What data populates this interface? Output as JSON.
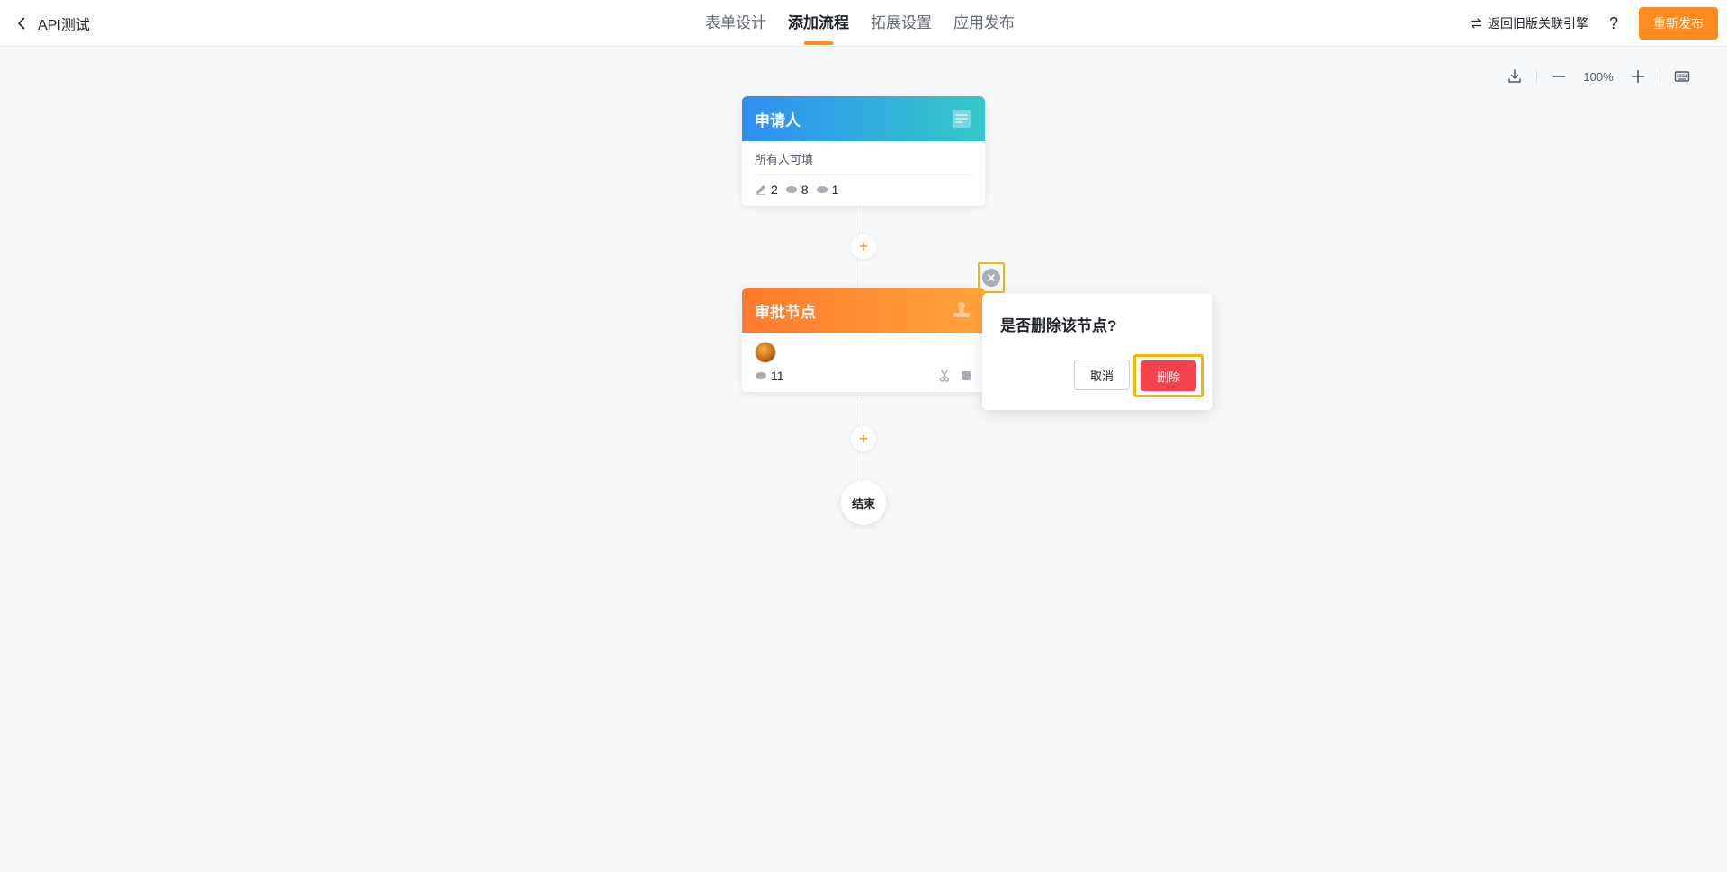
{
  "header": {
    "app_title": "API测试",
    "tabs": [
      {
        "label": "表单设计",
        "active": false
      },
      {
        "label": "添加流程",
        "active": true
      },
      {
        "label": "拓展设置",
        "active": false
      },
      {
        "label": "应用发布",
        "active": false
      }
    ],
    "legacy_link": "返回旧版关联引擎",
    "help": "?",
    "publish_label": "重新发布"
  },
  "zoom": {
    "value": "100%",
    "tools": [
      "download-icon",
      "zoom-out-icon",
      "zoom-in-icon",
      "keyboard-icon"
    ]
  },
  "flow": {
    "applicant": {
      "title": "申请人",
      "description": "所有人可填",
      "stats": {
        "edit": "2",
        "view": "8",
        "hidden": "1"
      }
    },
    "approval": {
      "title": "审批节点",
      "stats": {
        "view": "11"
      }
    },
    "add_symbol": "+",
    "end_label": "结束"
  },
  "popconfirm": {
    "message": "是否删除该节点?",
    "cancel_label": "取消",
    "delete_label": "删除"
  },
  "colors": {
    "accent": "#ff8a1f",
    "danger": "#f5414c",
    "highlight": "#f5b800",
    "applicant_gradient": [
      "#2f8ef4",
      "#35c8c8"
    ],
    "approval_gradient": [
      "#ff7a2e",
      "#ffa33b"
    ]
  }
}
